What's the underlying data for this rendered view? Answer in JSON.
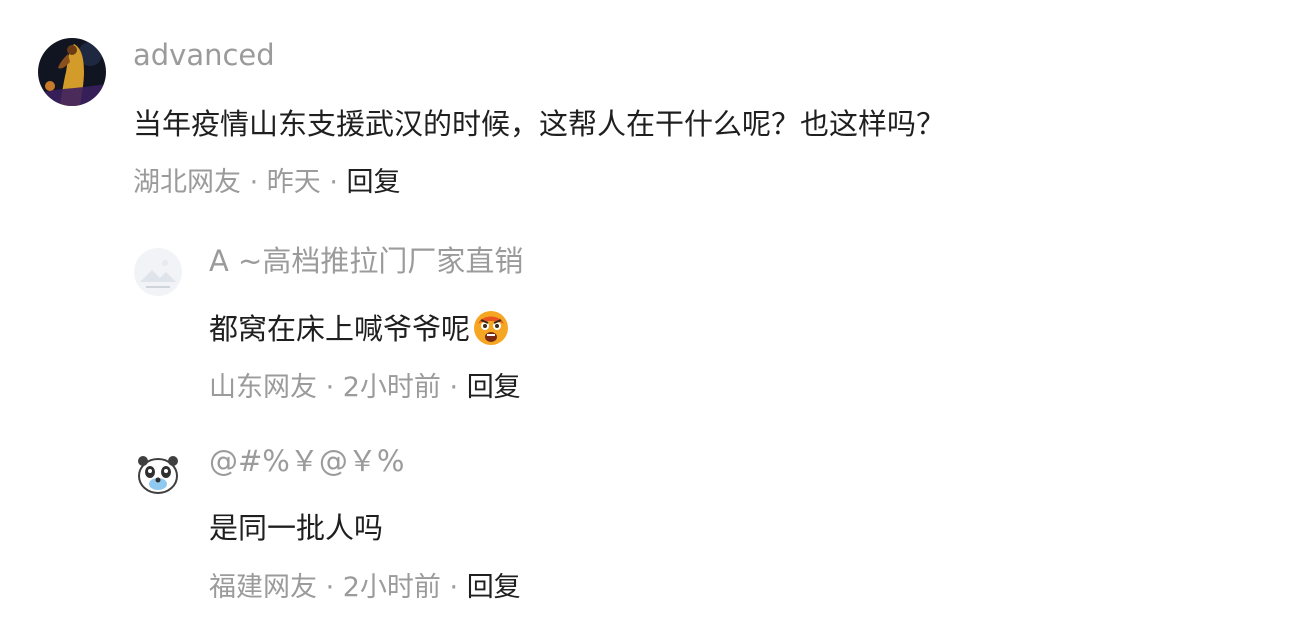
{
  "comments": [
    {
      "username": "advanced",
      "text": "当年疫情山东支援武汉的时候，这帮人在干什么呢？也这样吗？",
      "location": "湖北网友",
      "time": "昨天",
      "reply_label": "回复",
      "avatar_icon": "basketball-player-avatar"
    }
  ],
  "replies": [
    {
      "username": "A ~高档推拉门厂家直销",
      "text": "都窝在床上喊爷爷呢",
      "emoji": "angry-shocked-face-emoji",
      "location": "山东网友",
      "time": "2小时前",
      "reply_label": "回复",
      "avatar_icon": "landscape-placeholder-avatar"
    },
    {
      "username": "@#%￥@￥%",
      "text": "是同一批人吗",
      "location": "福建网友",
      "time": "2小时前",
      "reply_label": "回复",
      "avatar_icon": "cartoon-panda-avatar"
    }
  ],
  "separator": " · ",
  "colors": {
    "meta": "#9b9b9b",
    "text": "#1f1f1f",
    "reply": "#1f1f1f"
  }
}
